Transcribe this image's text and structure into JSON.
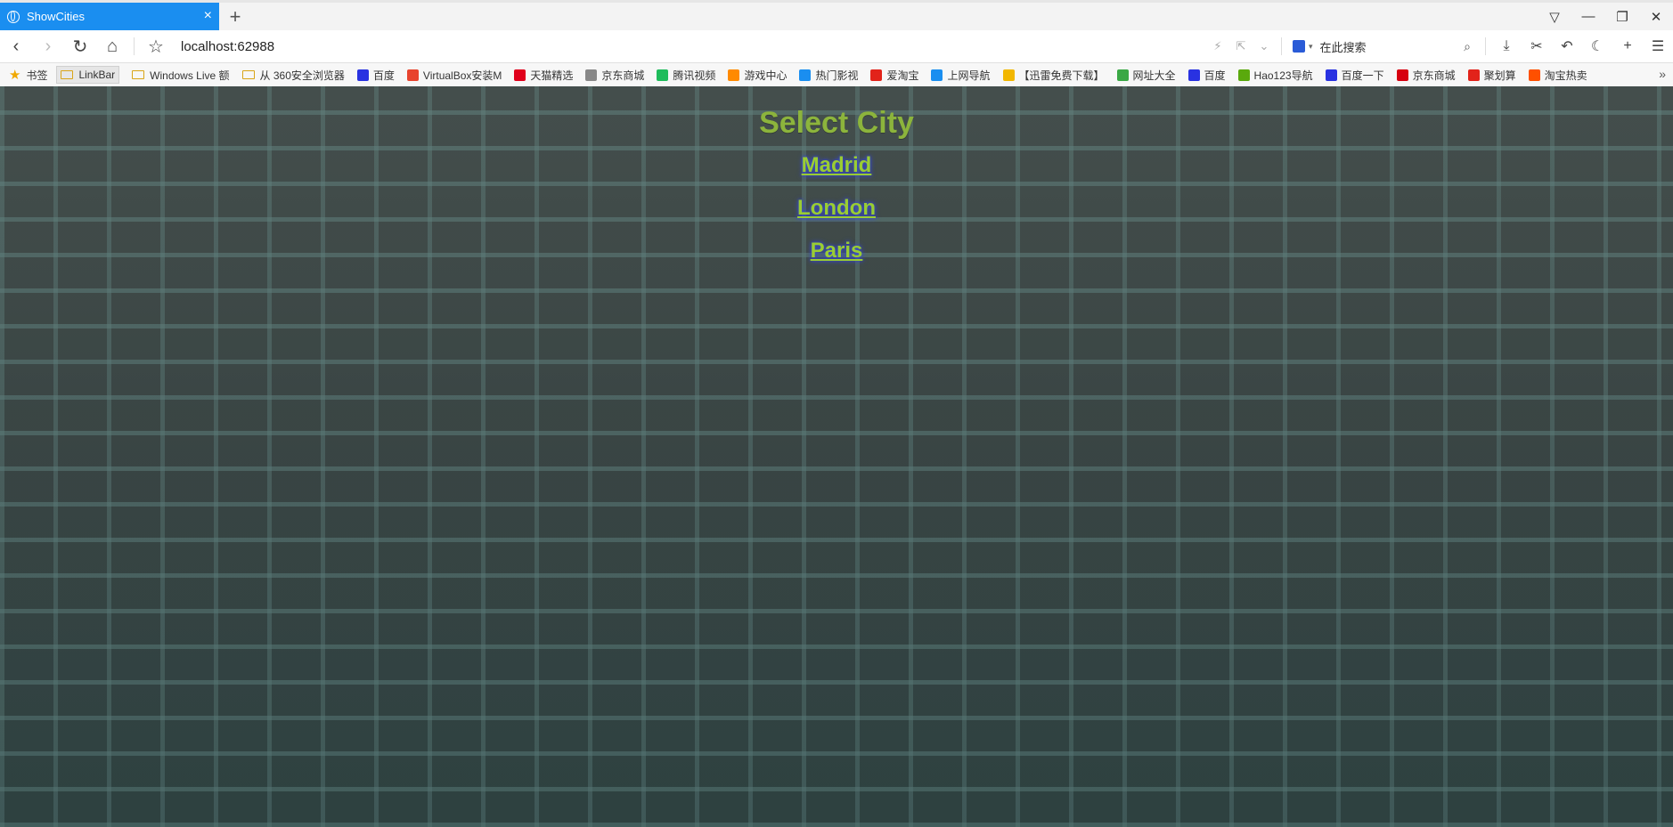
{
  "tab": {
    "title": "ShowCities",
    "close": "×",
    "new_tab": "+"
  },
  "window": {
    "pin": "▽",
    "minimize": "—",
    "restore": "❐",
    "close": "✕"
  },
  "address": {
    "back": "‹",
    "forward": "›",
    "reload": "↻",
    "home": "⌂",
    "star": "☆",
    "url": "localhost:62988",
    "search_placeholder": "在此搜索"
  },
  "bookmarks": [
    {
      "label": "书签",
      "icon": "star-icon"
    },
    {
      "label": "LinkBar",
      "icon": "folder-icon"
    },
    {
      "label": "Windows Live 额",
      "icon": "folder-icon"
    },
    {
      "label": "从 360安全浏览器",
      "icon": "folder-icon"
    },
    {
      "label": "百度",
      "icon": "baidu-icon",
      "color": "#2932e1"
    },
    {
      "label": "VirtualBox安装M",
      "icon": "c-icon",
      "color": "#e8442e"
    },
    {
      "label": "天猫精选",
      "icon": "tmall-icon",
      "color": "#e0001b"
    },
    {
      "label": "京东商城",
      "icon": "globe-icon",
      "color": "#888888"
    },
    {
      "label": "腾讯视频",
      "icon": "play-icon",
      "color": "#1ebc5b"
    },
    {
      "label": "游戏中心",
      "icon": "game-icon",
      "color": "#ff8a00"
    },
    {
      "label": "热门影视",
      "icon": "video-icon",
      "color": "#1a8ef0"
    },
    {
      "label": "爱淘宝",
      "icon": "taobao-icon",
      "color": "#e2231a"
    },
    {
      "label": "上网导航",
      "icon": "search-icon",
      "color": "#1a8ef0"
    },
    {
      "label": "【迅雷免费下载】",
      "icon": "xunlei-icon",
      "color": "#f2b700"
    },
    {
      "label": "网址大全",
      "icon": "check-icon",
      "color": "#3aa845"
    },
    {
      "label": "百度",
      "icon": "baidu-icon",
      "color": "#2932e1"
    },
    {
      "label": "Hao123导航",
      "icon": "hao-icon",
      "color": "#5aa90d"
    },
    {
      "label": "百度一下",
      "icon": "baidu-icon",
      "color": "#2932e1"
    },
    {
      "label": "京东商城",
      "icon": "jd-icon",
      "color": "#d7000f"
    },
    {
      "label": "聚划算",
      "icon": "juhuasuan-icon",
      "color": "#e2231a"
    },
    {
      "label": "淘宝热卖",
      "icon": "taobao-icon",
      "color": "#ff5000"
    }
  ],
  "bookmarks_more": "»",
  "page": {
    "title": "Select City",
    "cities": [
      "Madrid",
      "London",
      "Paris"
    ]
  },
  "colors": {
    "tab_active": "#1a8ef0",
    "title": "#8cb43c",
    "link": "#9acd32"
  }
}
